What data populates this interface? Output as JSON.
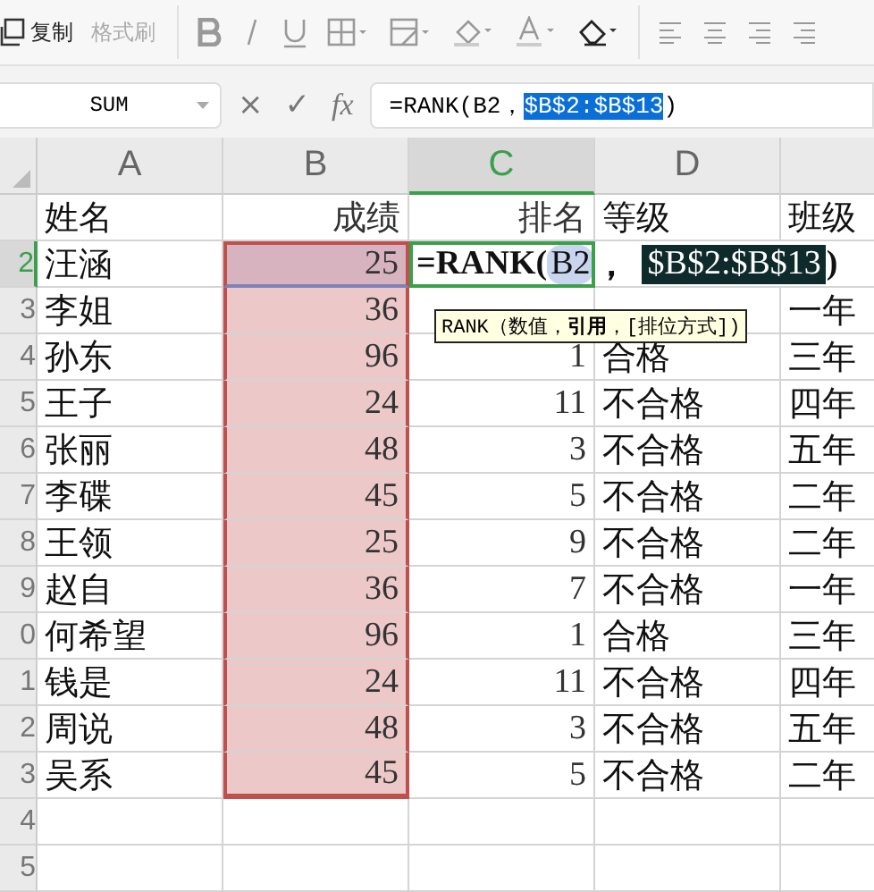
{
  "toolbar": {
    "clipboard": [
      {
        "label": "复制",
        "disabled": false
      },
      {
        "label": "格式刷",
        "disabled": true
      }
    ]
  },
  "formula_bar": {
    "name_box": "SUM",
    "cancel": "×",
    "confirm": "✓",
    "fx": "fx",
    "formula_prefix": "=RANK(B2，",
    "formula_selected": "$B$2:$B$13",
    "formula_suffix": ")"
  },
  "columns": [
    {
      "label": "A",
      "selected": false
    },
    {
      "label": "B",
      "selected": false
    },
    {
      "label": "C",
      "selected": true
    },
    {
      "label": "D",
      "selected": false
    },
    {
      "selected": false
    }
  ],
  "rows": [
    {
      "number": "",
      "selected": false,
      "in_range": false,
      "cells": [
        "姓名",
        "成绩",
        "排名",
        "等级",
        "班级"
      ]
    },
    {
      "number": "2",
      "selected": true,
      "in_range": true,
      "cells": [
        "汪涵",
        "25",
        "",
        "",
        ""
      ],
      "formula": {
        "prefix": "=RANK(",
        "ref": "B2",
        "sep": "，",
        "range": "$B$2:$B$13",
        "suffix": ")"
      }
    },
    {
      "number": "3",
      "selected": false,
      "in_range": true,
      "cells": [
        "李姐",
        "36",
        "",
        "",
        "一年"
      ]
    },
    {
      "number": "4",
      "selected": false,
      "in_range": true,
      "cells": [
        "孙东",
        "96",
        "1",
        "合格",
        "三年"
      ]
    },
    {
      "number": "5",
      "selected": false,
      "in_range": true,
      "cells": [
        "王子",
        "24",
        "11",
        "不合格",
        "四年"
      ]
    },
    {
      "number": "6",
      "selected": false,
      "in_range": true,
      "cells": [
        "张丽",
        "48",
        "3",
        "不合格",
        "五年"
      ]
    },
    {
      "number": "7",
      "selected": false,
      "in_range": true,
      "cells": [
        "李碟",
        "45",
        "5",
        "不合格",
        "二年"
      ]
    },
    {
      "number": "8",
      "selected": false,
      "in_range": true,
      "cells": [
        "王领",
        "25",
        "9",
        "不合格",
        "二年"
      ]
    },
    {
      "number": "9",
      "selected": false,
      "in_range": true,
      "cells": [
        "赵自",
        "36",
        "7",
        "不合格",
        "一年"
      ]
    },
    {
      "number": "0",
      "selected": false,
      "in_range": true,
      "cells": [
        "何希望",
        "96",
        "1",
        "合格",
        "三年"
      ]
    },
    {
      "number": "1",
      "selected": false,
      "in_range": true,
      "cells": [
        "钱是",
        "24",
        "11",
        "不合格",
        "四年"
      ]
    },
    {
      "number": "2",
      "selected": false,
      "in_range": true,
      "cells": [
        "周说",
        "48",
        "3",
        "不合格",
        "五年"
      ]
    },
    {
      "number": "3",
      "selected": false,
      "in_range": true,
      "cells": [
        "吴系",
        "45",
        "5",
        "不合格",
        "二年"
      ]
    },
    {
      "number": "4",
      "selected": false,
      "in_range": false,
      "cells": [
        "",
        "",
        "",
        "",
        ""
      ]
    },
    {
      "number": "5",
      "selected": false,
      "in_range": false,
      "cells": [
        "",
        "",
        "",
        "",
        ""
      ]
    }
  ],
  "tooltip": "RANK（数值，**引用**，[排位方式])"
}
